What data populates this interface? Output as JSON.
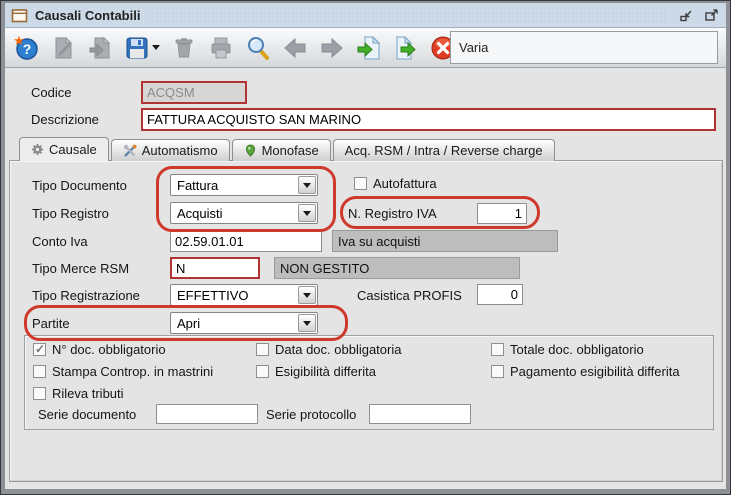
{
  "window": {
    "title": "Causali Contabili"
  },
  "toolbar": {
    "context_value": "Varia",
    "buttons": [
      {
        "name": "help",
        "enabled": true
      },
      {
        "name": "edit-document",
        "enabled": false
      },
      {
        "name": "duplicate-document",
        "enabled": false
      },
      {
        "name": "save",
        "enabled": true,
        "has_dropdown": true
      },
      {
        "name": "delete",
        "enabled": false
      },
      {
        "name": "print",
        "enabled": false
      },
      {
        "name": "search",
        "enabled": true
      },
      {
        "name": "previous",
        "enabled": false
      },
      {
        "name": "next",
        "enabled": false
      },
      {
        "name": "document-in",
        "enabled": true
      },
      {
        "name": "document-out",
        "enabled": true
      },
      {
        "name": "close",
        "enabled": true
      }
    ]
  },
  "header": {
    "codice_label": "Codice",
    "codice_value": "ACQSM",
    "descrizione_label": "Descrizione",
    "descrizione_value": "FATTURA ACQUISTO SAN MARINO"
  },
  "tabs": [
    {
      "label": "Causale",
      "icon": "gear-icon",
      "active": true
    },
    {
      "label": "Automatismo",
      "icon": "tools-icon",
      "active": false
    },
    {
      "label": "Monofase",
      "icon": "pin-icon",
      "active": false
    },
    {
      "label": "Acq. RSM / Intra / Reverse charge",
      "icon": "",
      "active": false
    }
  ],
  "form": {
    "tipo_documento": {
      "label": "Tipo Documento",
      "value": "Fattura"
    },
    "autofattura": {
      "label": "Autofattura",
      "checked": false
    },
    "tipo_registro": {
      "label": "Tipo Registro",
      "value": "Acquisti"
    },
    "n_registro_iva": {
      "label": "N. Registro IVA",
      "value": "1"
    },
    "conto_iva": {
      "label": "Conto Iva",
      "value": "02.59.01.01",
      "description": "Iva su acquisti"
    },
    "tipo_merce_rsm": {
      "label": "Tipo Merce RSM",
      "value": "N",
      "description": "NON GESTITO"
    },
    "tipo_registrazione": {
      "label": "Tipo Registrazione",
      "value": "EFFETTIVO"
    },
    "casistica_profis": {
      "label": "Casistica PROFIS",
      "value": "0"
    },
    "partite": {
      "label": "Partite",
      "value": "Apri"
    },
    "options": [
      {
        "label": "N° doc. obbligatorio",
        "checked": true
      },
      {
        "label": "Data doc. obbligatoria",
        "checked": false
      },
      {
        "label": "Totale doc. obbligatorio",
        "checked": false
      },
      {
        "label": "Stampa Controp. in mastrini",
        "checked": false
      },
      {
        "label": "Esigibilità differita",
        "checked": false
      },
      {
        "label": "Pagamento esigibilità differita",
        "checked": false
      },
      {
        "label": "Rileva tributi",
        "checked": false
      }
    ],
    "serie_documento": {
      "label": "Serie documento",
      "value": ""
    },
    "serie_protocollo": {
      "label": "Serie protocollo",
      "value": ""
    }
  },
  "colors": {
    "annotation": "#cf392b",
    "field_alert_border": "#b03434",
    "titlebar": "#ccd9e6"
  }
}
